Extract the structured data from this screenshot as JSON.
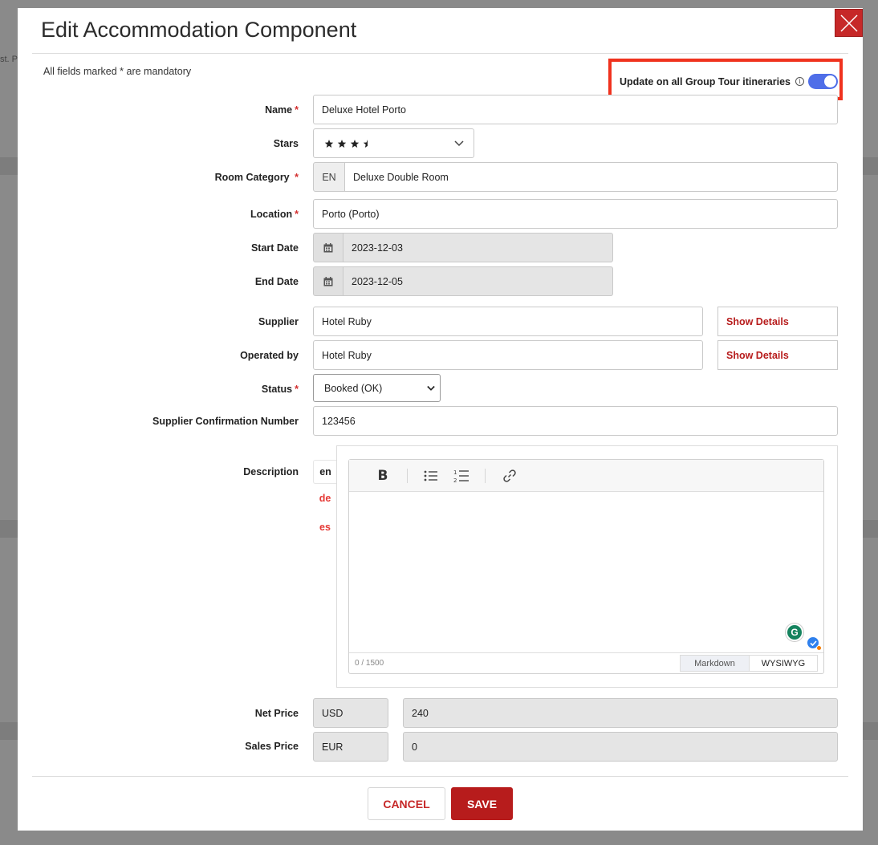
{
  "background": {
    "partial_text": "st. P"
  },
  "modal": {
    "title": "Edit Accommodation Component",
    "mandatory_note": "All fields marked * are mandatory",
    "update_all": {
      "label": "Update on all Group Tour itineraries",
      "info_glyph": "i",
      "enabled": true
    },
    "fields": {
      "name": {
        "label": "Name",
        "required": "*",
        "value": "Deluxe Hotel Porto"
      },
      "stars": {
        "label": "Stars",
        "rating": 3.5,
        "max": 4
      },
      "room_category": {
        "label": "Room Category",
        "required": "*",
        "lang": "EN",
        "value": "Deluxe Double Room"
      },
      "location": {
        "label": "Location",
        "required": "*",
        "value": "Porto (Porto)"
      },
      "start_date": {
        "label": "Start Date",
        "value": "2023-12-03"
      },
      "end_date": {
        "label": "End Date",
        "value": "2023-12-05"
      },
      "supplier": {
        "label": "Supplier",
        "value": "Hotel Ruby",
        "details": "Show Details"
      },
      "operated_by": {
        "label": "Operated by",
        "value": "Hotel Ruby",
        "details": "Show Details"
      },
      "status": {
        "label": "Status",
        "required": "*",
        "value": "Booked (OK)"
      },
      "confirmation": {
        "label": "Supplier Confirmation Number",
        "value": "123456"
      },
      "description": {
        "label": "Description",
        "languages": [
          "en",
          "de",
          "es"
        ],
        "counter": "0 / 1500",
        "mode_markdown": "Markdown",
        "mode_wysiwyg": "WYSIWYG",
        "bold_glyph": "B",
        "grammarly_glyph": "G"
      },
      "net_price": {
        "label": "Net Price",
        "currency": "USD",
        "value": "240"
      },
      "sales_price": {
        "label": "Sales Price",
        "currency": "EUR",
        "value": "0"
      }
    },
    "actions": {
      "cancel": "CANCEL",
      "save": "SAVE"
    }
  },
  "colors": {
    "accent_red": "#b71c1c",
    "toggle_blue": "#4f6ee8",
    "highlight": "#f0321e"
  }
}
